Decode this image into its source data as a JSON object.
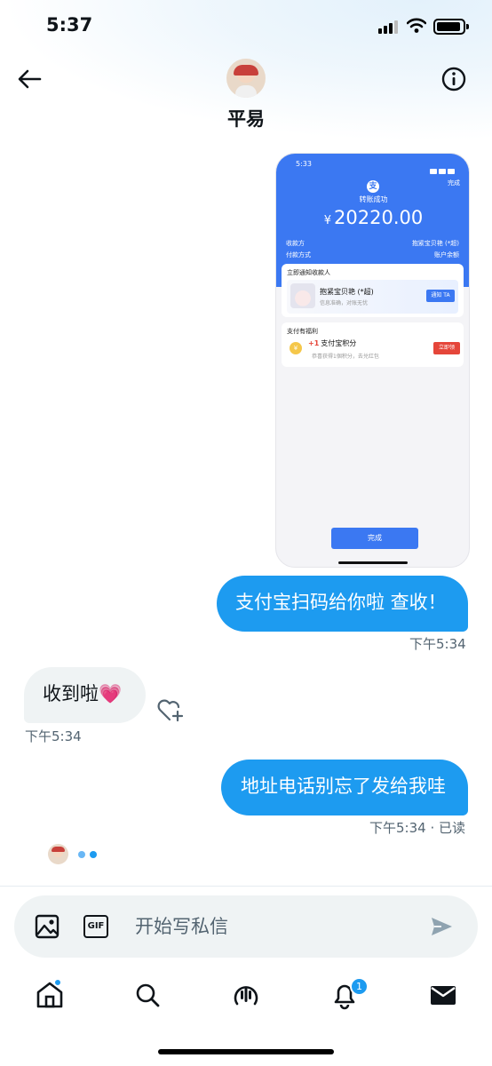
{
  "status_bar": {
    "time": "5:37"
  },
  "header": {
    "contact_name": "平易"
  },
  "shared_screenshot": {
    "time": "5:33",
    "done_top": "完成",
    "title": "转账成功",
    "currency": "¥",
    "amount": "20220.00",
    "payee_label": "收款方",
    "payee_value": "抱紧宝贝艳 (*超)",
    "pay_method_label": "付款方式",
    "pay_method_value": "账户余额",
    "notify_title": "立即通知收款人",
    "notify_name": "抱紧宝贝艳 (*超)",
    "notify_sub": "信息准确，对账无忧",
    "notify_button": "通知 TA",
    "benefit_title": "支付有福利",
    "benefit_plus": "+1",
    "benefit_text": "支付宝积分",
    "benefit_sub": "恭喜获得1個积分，去兑红包",
    "benefit_button": "立即领",
    "done_button": "完成"
  },
  "messages": [
    {
      "text": "支付宝扫码给你啦 查收！",
      "time": "下午5:34"
    },
    {
      "text": "收到啦💗",
      "time": "下午5:34"
    },
    {
      "text": "地址电话别忘了发给我哇",
      "time": "下午5:34 · 已读"
    }
  ],
  "composer": {
    "placeholder": "开始写私信"
  },
  "nav": {
    "notification_count": "1"
  },
  "colors": {
    "accent": "#1d9bf0",
    "alipay_blue": "#3b78f2"
  }
}
